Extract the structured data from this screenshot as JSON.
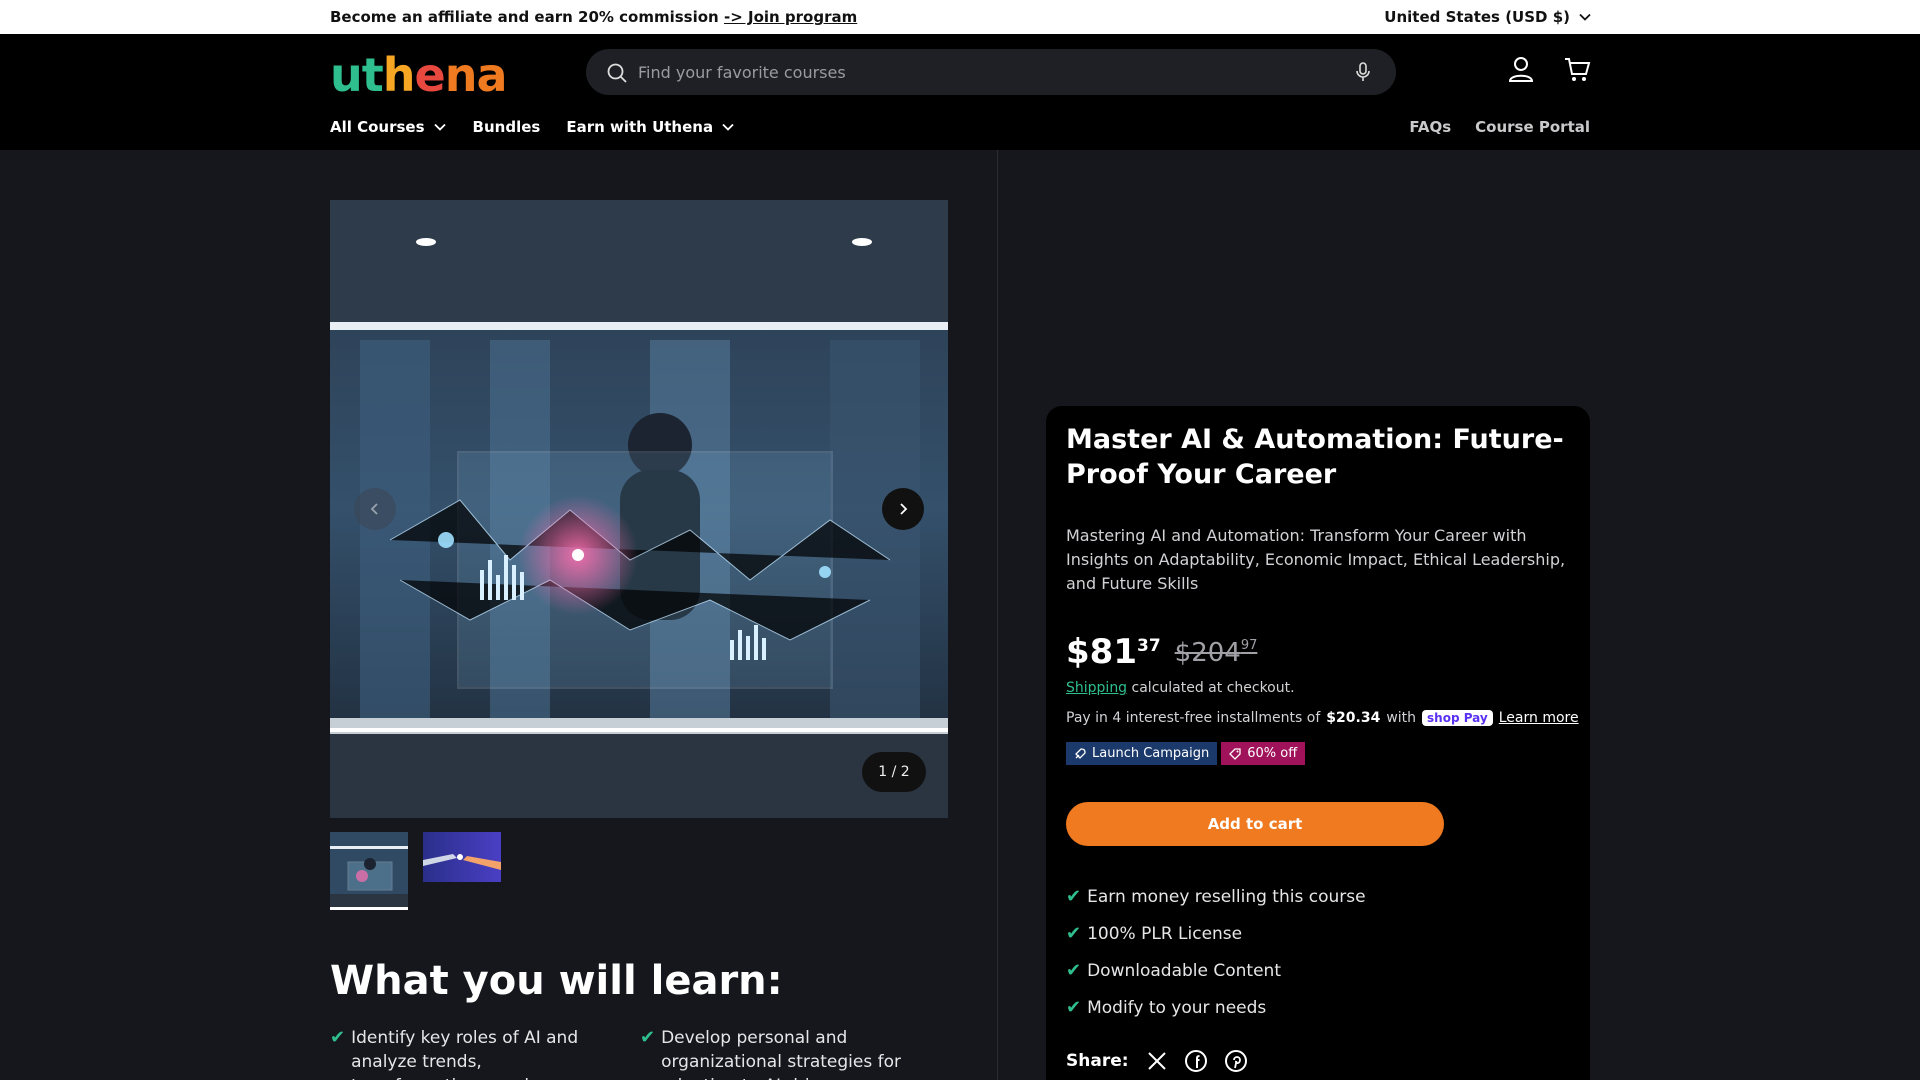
{
  "announcement": {
    "text": "Become an affiliate and earn 20% commission",
    "link": "-> Join program",
    "country": "United States (USD $)"
  },
  "header": {
    "logo": [
      "u",
      "t",
      "h",
      "e",
      "n",
      "a"
    ],
    "logo_colors": [
      "#2fbf8f",
      "#2fbf8f",
      "#f6a623",
      "#e8493f",
      "#f07a1f",
      "#f07a1f"
    ],
    "search_placeholder": "Find your favorite courses",
    "nav": [
      "All Courses",
      "Bundles",
      "Earn with Uthena"
    ],
    "nav_right": [
      "FAQs",
      "Course Portal"
    ]
  },
  "gallery": {
    "counter": "1 / 2"
  },
  "learn": {
    "title": "What you will learn:",
    "items": [
      "Identify key roles of AI and analyze trends, transformations, and case",
      "Develop personal and organizational strategies for adapting to AI-driven"
    ]
  },
  "product": {
    "title": "Master AI & Automation: Future-Proof Your Career",
    "description": "Mastering AI and Automation: Transform Your Career with Insights on Adaptability, Economic Impact, Ethical Leadership, and Future Skills",
    "price_whole": "$81",
    "price_cents": "37",
    "was_whole": "$204",
    "was_cents": "97",
    "shipping_link": "Shipping",
    "shipping_text": "calculated at checkout.",
    "install_prefix": "Pay in 4 interest-free installments of",
    "install_amount": "$20.34",
    "install_with": "with",
    "shoppay": "shop Pay",
    "learn_more": "Learn more",
    "badge_campaign": "Launch Campaign",
    "badge_discount": "60% off",
    "add_to_cart": "Add to cart",
    "features": [
      "Earn money reselling this course",
      "100% PLR License",
      "Downloadable Content",
      "Modify to your needs"
    ],
    "share_label": "Share:"
  },
  "colors": {
    "accent": "#f07a1f",
    "green": "#2fbf8f",
    "badge_blue": "#1b3a6b",
    "badge_pink": "#a0125a"
  }
}
